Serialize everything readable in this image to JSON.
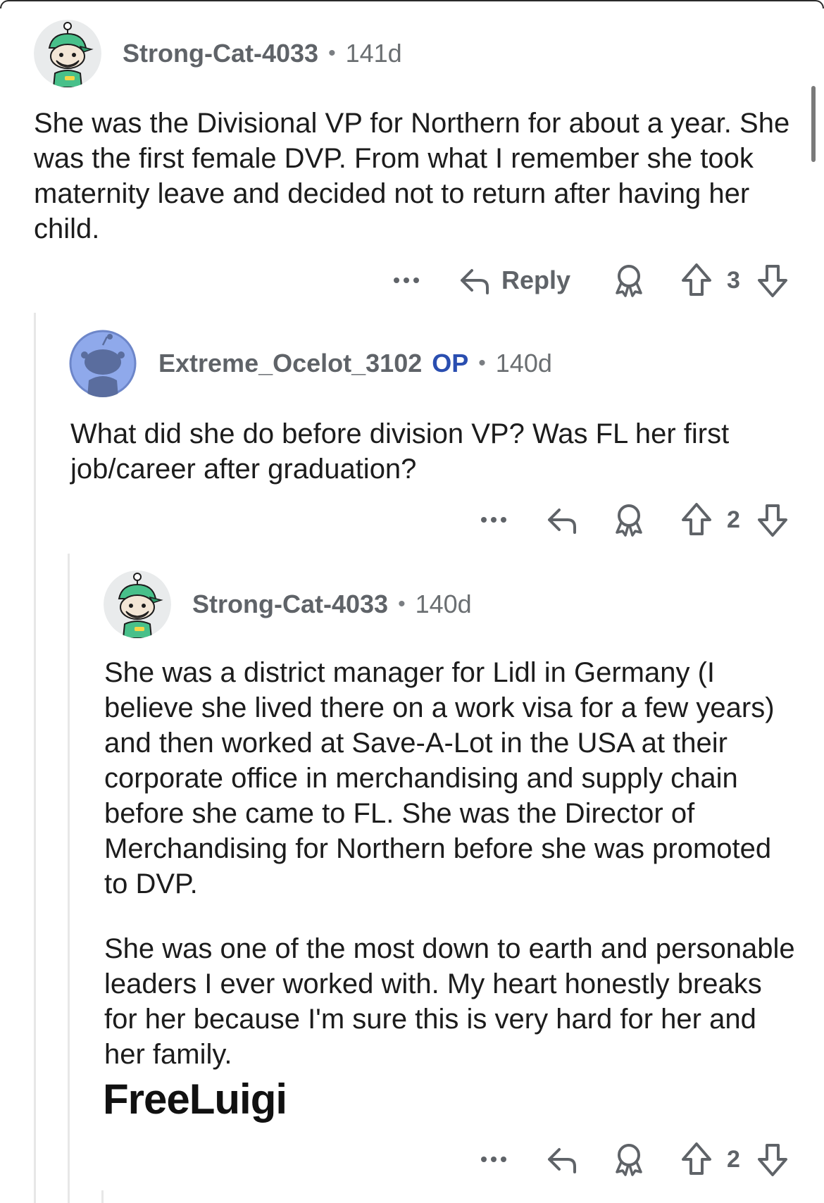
{
  "comments": [
    {
      "username": "Strong-Cat-4033",
      "age": "141d",
      "paragraphs": [
        "She was the Divisional VP for Northern for about a year. She was the first female DVP. From what I remember she took maternity leave and decided not to return after having her child."
      ],
      "reply_label": "Reply",
      "score": "3",
      "avatar_icon": "snoo-green-cap-avatar"
    },
    {
      "username": "Extreme_Ocelot_3102",
      "op_badge": "OP",
      "age": "140d",
      "paragraphs": [
        "What did she do before division VP? Was FL her first job/career after graduation?"
      ],
      "score": "2",
      "avatar_icon": "default-snoo-avatar"
    },
    {
      "username": "Strong-Cat-4033",
      "age": "140d",
      "paragraphs": [
        "She was a district manager for Lidl in Germany (I believe she lived there on a work visa for a few years) and then worked at Save-A-Lot in the USA at their corporate office in merchandising and supply chain before she came to FL. She was the Director of Merchandising for Northern before she was promoted to DVP.",
        "She was one of the most down to earth and personable leaders I ever worked with. My heart honestly breaks for her because I'm sure this is very hard for her and her family."
      ],
      "signature": "FreeLuigi",
      "score": "2",
      "avatar_icon": "snoo-green-cap-avatar"
    }
  ],
  "separator": "•",
  "colors": {
    "text": "#1c1c1c",
    "meta": "#6b6f72",
    "op_badge": "#2a4eb0",
    "thread_line": "#e7e7e7",
    "icon": "#5f6368"
  }
}
